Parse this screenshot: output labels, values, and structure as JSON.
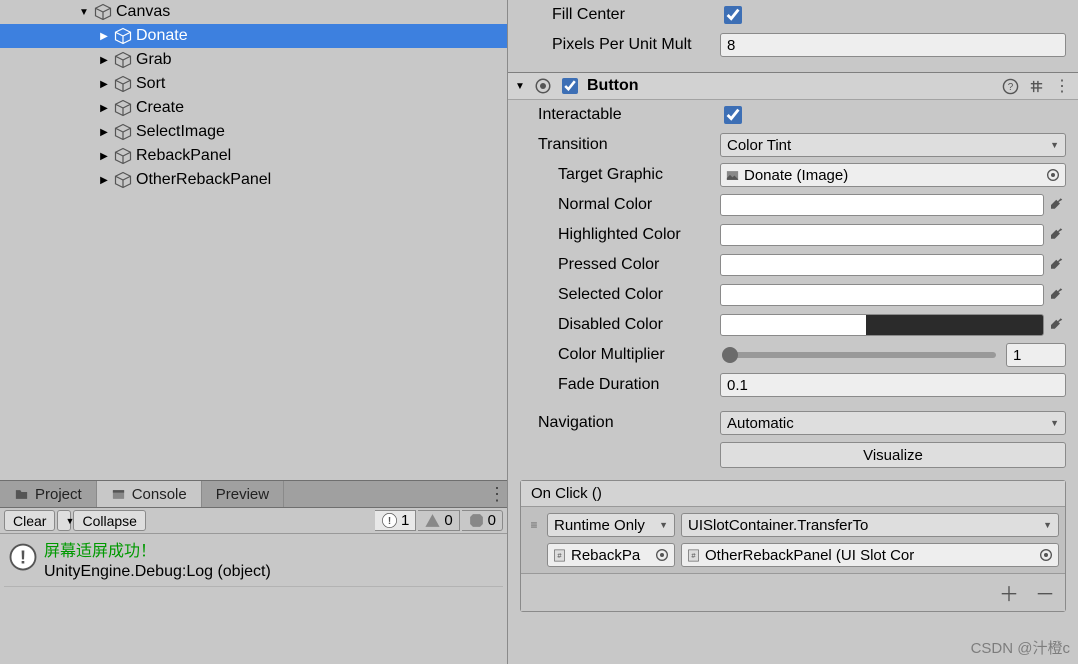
{
  "hierarchy": {
    "parent": "Canvas",
    "items": [
      "Donate",
      "Grab",
      "Sort",
      "Create",
      "SelectImage",
      "RebackPanel",
      "OtherRebackPanel"
    ],
    "selected": 0
  },
  "tabs": {
    "project": "Project",
    "console": "Console",
    "preview": "Preview"
  },
  "console": {
    "clear": "Clear",
    "collapse": "Collapse",
    "info_count": "1",
    "warn_count": "0",
    "error_count": "0",
    "log": {
      "line1": "屏幕适屏成功！",
      "line2": "UnityEngine.Debug:Log (object)"
    }
  },
  "image_component": {
    "fill_center": "Fill Center",
    "ppum_label": "Pixels Per Unit Mult",
    "ppum_value": "8"
  },
  "button_component": {
    "title": "Button",
    "interactable": "Interactable",
    "transition": "Transition",
    "transition_value": "Color Tint",
    "target_graphic": "Target Graphic",
    "target_graphic_value": "Donate (Image)",
    "normal_color": "Normal Color",
    "highlighted_color": "Highlighted Color",
    "pressed_color": "Pressed Color",
    "selected_color": "Selected Color",
    "disabled_color": "Disabled Color",
    "color_multiplier": "Color Multiplier",
    "color_multiplier_value": "1",
    "fade_duration": "Fade Duration",
    "fade_duration_value": "0.1",
    "navigation": "Navigation",
    "navigation_value": "Automatic",
    "visualize": "Visualize"
  },
  "events": {
    "header": "On Click ()",
    "call_state": "Runtime Only",
    "function": "UISlotContainer.TransferTo",
    "target": "RebackPa",
    "argument": "OtherRebackPanel (UI Slot Cor"
  },
  "watermark": "CSDN @汁橙c"
}
